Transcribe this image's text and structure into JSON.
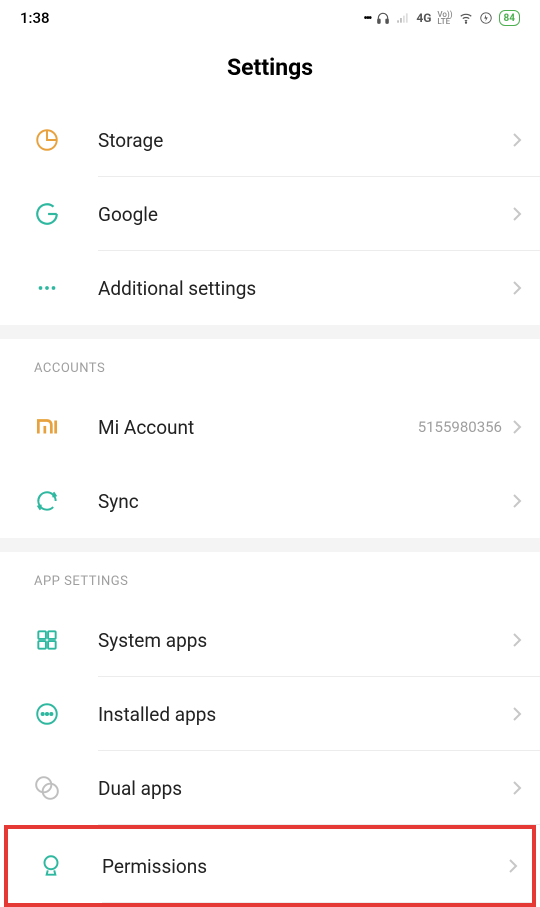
{
  "status": {
    "time": "1:38",
    "network": "4G",
    "volte": "Vo))\nLTE",
    "battery": "84"
  },
  "title": "Settings",
  "group1": [
    {
      "label": "Storage"
    },
    {
      "label": "Google"
    },
    {
      "label": "Additional settings"
    }
  ],
  "sectionAccounts": "ACCOUNTS",
  "accounts": [
    {
      "label": "Mi Account",
      "value": "5155980356"
    },
    {
      "label": "Sync"
    }
  ],
  "sectionAppSettings": "APP SETTINGS",
  "appsettings": [
    {
      "label": "System apps"
    },
    {
      "label": "Installed apps"
    },
    {
      "label": "Dual apps"
    },
    {
      "label": "Permissions"
    }
  ]
}
